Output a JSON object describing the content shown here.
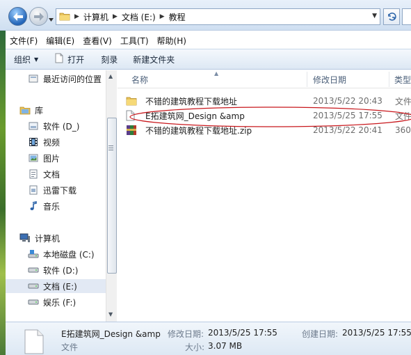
{
  "address": {
    "crumbs": [
      "计算机",
      "文档 (E:)",
      "教程"
    ]
  },
  "menu": [
    "文件(F)",
    "编辑(E)",
    "查看(V)",
    "工具(T)",
    "帮助(H)"
  ],
  "toolbar": {
    "organize": "组织",
    "open": "打开",
    "burn": "刻录",
    "new_folder": "新建文件夹"
  },
  "nav": {
    "recent": "最近访问的位置",
    "library": "库",
    "lib_software": "软件 (D_)",
    "lib_video": "视频",
    "lib_pictures": "图片",
    "lib_docs": "文档",
    "lib_xunlei": "迅雷下载",
    "lib_music": "音乐",
    "computer": "计算机",
    "drive_c": "本地磁盘 (C:)",
    "drive_d": "软件 (D:)",
    "drive_e": "文档 (E:)",
    "drive_f": "娱乐 (F:)"
  },
  "columns": {
    "name": "名称",
    "modified": "修改日期",
    "type": "类型"
  },
  "files": [
    {
      "name": "不错的建筑教程下载地址",
      "date": "2013/5/22 20:43",
      "type": "文件",
      "icon": "folder-icon"
    },
    {
      "name": "E拓建筑网_Design &amp",
      "date": "2013/5/25 17:55",
      "type": "文件",
      "icon": "blank-file-icon"
    },
    {
      "name": "不错的建筑教程下载地址.zip",
      "date": "2013/5/22 20:41",
      "type": "360",
      "icon": "zip-archive-icon"
    }
  ],
  "details": {
    "name": "E拓建筑网_Design &amp",
    "kind": "文件",
    "modified_label": "修改日期:",
    "modified_value": "2013/5/25 17:55",
    "created_label": "创建日期:",
    "created_value": "2013/5/25 17:55",
    "size_label": "大小:",
    "size_value": "3.07 MB"
  },
  "colors": {
    "chrome": "#cfdff1",
    "selection": "#e2e9f4",
    "annotation_red": "#c8171c"
  }
}
